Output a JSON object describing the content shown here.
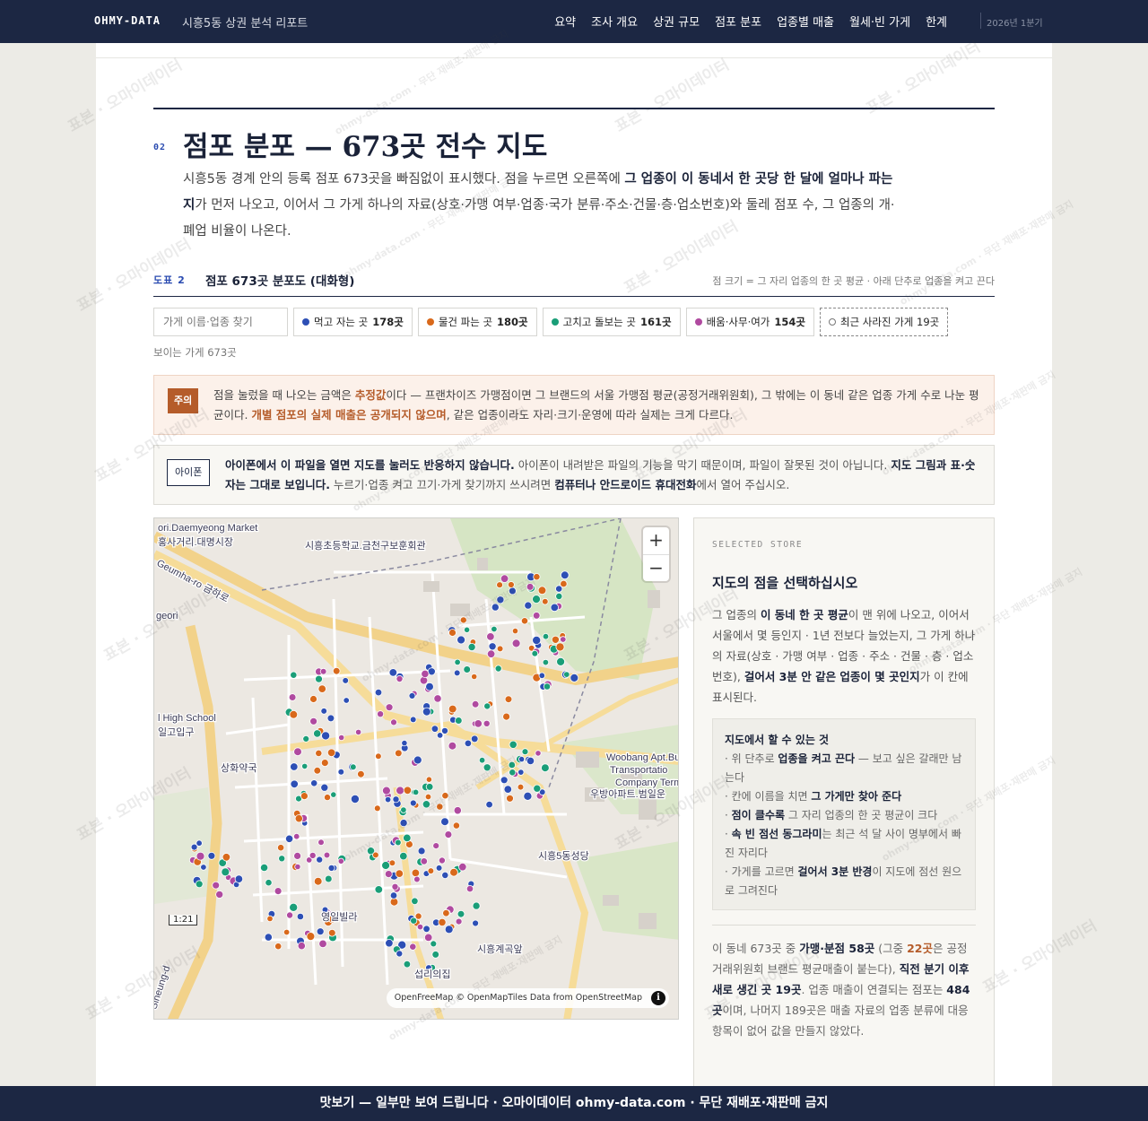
{
  "nav": {
    "brand": "OHMY-DATA",
    "subtitle": "시흥5동 상권 분석 리포트",
    "links": [
      "요약",
      "조사 개요",
      "상권 규모",
      "점포 분포",
      "업종별 매출",
      "월세·빈 가게",
      "한계"
    ],
    "period": "2026년 1분기"
  },
  "section": {
    "number": "02",
    "title": "점포 분포 — 673곳 전수 지도",
    "intro_1": "시흥5동 경계 안의 등록 점포 673곳을 빠짐없이 표시했다. 점을 누르면 오른쪽에 ",
    "intro_bold": "그 업종이 이 동네서 한 곳당 한 달에 얼마나 파는지",
    "intro_2": "가 먼저 나오고, 이어서 그 가게 하나의 자료(상호·가맹 여부·업종·국가 분류·주소·건물·층·업소번호)와 둘레 점포 수, 그 업종의 개·폐업 비율이 나온다."
  },
  "figure": {
    "label": "도표 2",
    "title": "점포 673곳 분포도 (대화형)",
    "note": "점 크기 = 그 자리 업종의 한 곳 평균 · 아래 단추로 업종을 켜고 끈다"
  },
  "filters": {
    "search_placeholder": "가게 이름·업종 찾기",
    "chips": [
      {
        "label": "먹고 자는 곳",
        "count": "178곳",
        "color": "#2d4fb5"
      },
      {
        "label": "물건 파는 곳",
        "count": "180곳",
        "color": "#d9691b"
      },
      {
        "label": "고치고 돌보는 곳",
        "count": "161곳",
        "color": "#1a9e78"
      },
      {
        "label": "배움·사무·여가",
        "count": "154곳",
        "color": "#b04aa0"
      }
    ],
    "closed_label": "최근 사라진 가게 19곳",
    "visible_count": "보이는 가게 673곳"
  },
  "notice_warn": {
    "tag": "주의",
    "text_1": "점을 눌렀을 때 나오는 금액은 ",
    "bold_1": "추정값",
    "text_2": "이다 — 프랜차이즈 가맹점이면 그 브랜드의 서울 가맹점 평균(공정거래위원회), 그 밖에는 이 동네 같은 업종 가게 수로 나눈 평균이다. ",
    "bold_2": "개별 점포의 실제 매출은 공개되지 않으며",
    "text_3": ", 같은 업종이라도 자리·크기·운영에 따라 실제는 크게 다르다."
  },
  "notice_iphone": {
    "tag": "아이폰",
    "bold_1": "아이폰에서 이 파일을 열면 지도를 눌러도 반응하지 않습니다.",
    "text_1": " 아이폰이 내려받은 파일의 기능을 막기 때문이며, 파일이 잘못된 것이 아닙니다. ",
    "bold_2": "지도 그림과 표·숫자는 그대로 보입니다.",
    "text_2": " 누르기·업종 켜고 끄기·가게 찾기까지 쓰시려면 ",
    "bold_3": "컴퓨터나 안드로이드 휴대전화",
    "text_3": "에서 열어 주십시오."
  },
  "map": {
    "labels": [
      "ori.Daemyeong Market",
      "홍사거리.대명시장",
      "시흥초등학교.금천구보훈회관",
      "Geumha-ro 금하로",
      "geori",
      "l High School",
      "일고입구",
      "상화약국",
      "Woobang Apt.Bus",
      "Transportatio",
      "Company Termi",
      "우방아파트.범일운",
      "시흥5동성당",
      "영일빌라",
      "시흥계곡앞",
      "섭리의집",
      "Siheung-d"
    ],
    "zoom_in": "+",
    "zoom_out": "−",
    "scale": "1:21",
    "attribution": "OpenFreeMap © OpenMapTiles Data from OpenStreetMap",
    "info": "i"
  },
  "panel": {
    "label": "SELECTED STORE",
    "title": "지도의 점을 선택하십시오",
    "desc_1": "그 업종의 ",
    "desc_b1": "이 동네 한 곳 평균",
    "desc_2": "이 맨 위에 나오고, 이어서 서울에서 몇 등인지 · 1년 전보다 늘었는지, 그 가게 하나의 자료(상호 · 가맹 여부 · 업종 · 주소 · 건물 · 층 · 업소번호), ",
    "desc_b2": "걸어서 3분 안 같은 업종이 몇 곳인지",
    "desc_3": "가 이 칸에 표시된다.",
    "howto_title": "지도에서 할 수 있는 것",
    "howto": [
      {
        "pre": "· 위 단추로 ",
        "bold": "업종을 켜고 끈다",
        "post": " — 보고 싶은 갈래만 남는다"
      },
      {
        "pre": "· 칸에 이름을 치면 ",
        "bold": "그 가게만 찾아 준다",
        "post": ""
      },
      {
        "pre": "· ",
        "bold": "점이 클수록",
        "post": " 그 자리 업종의 한 곳 평균이 크다"
      },
      {
        "pre": "· ",
        "bold": "속 빈 점선 동그라미",
        "post": "는 최근 석 달 사이 명부에서 빠진 자리다"
      },
      {
        "pre": "· 가게를 고르면 ",
        "bold": "걸어서 3분 반경",
        "post": "이 지도에 점선 원으로 그려진다"
      }
    ],
    "stats_1": "이 동네 673곳 중 ",
    "stats_b1": "가맹·분점 58곳",
    "stats_2": " (그중 ",
    "stats_b2": "22곳",
    "stats_3": "은 공정거래위원회 브랜드 평균매출이 붙는다), ",
    "stats_b3": "직전 분기 이후 새로 생긴 곳 19곳",
    "stats_4": ". 업종 매출이 연결되는 점포는 ",
    "stats_b4": "484곳",
    "stats_5": "이며, 나머지 189곳은 매출 자료의 업종 분류에 대응 항목이 없어 값을 만들지 않았다."
  },
  "footer": "맛보기 — 일부만 보여 드립니다 · 오마이데이터 ohmy-data.com · 무단 재배포·재판매 금지",
  "watermark": [
    "표본 · 오마이데이터",
    "ohmy-data.com · 무단 재배포·재판매 금지"
  ],
  "colors": {
    "navy": "#1c2743",
    "accent_blue": "#2a4bb0",
    "warn_orange": "#b55c2a",
    "eat": "#2d4fb5",
    "shop": "#d9691b",
    "repair": "#1a9e78",
    "edu": "#b04aa0"
  }
}
